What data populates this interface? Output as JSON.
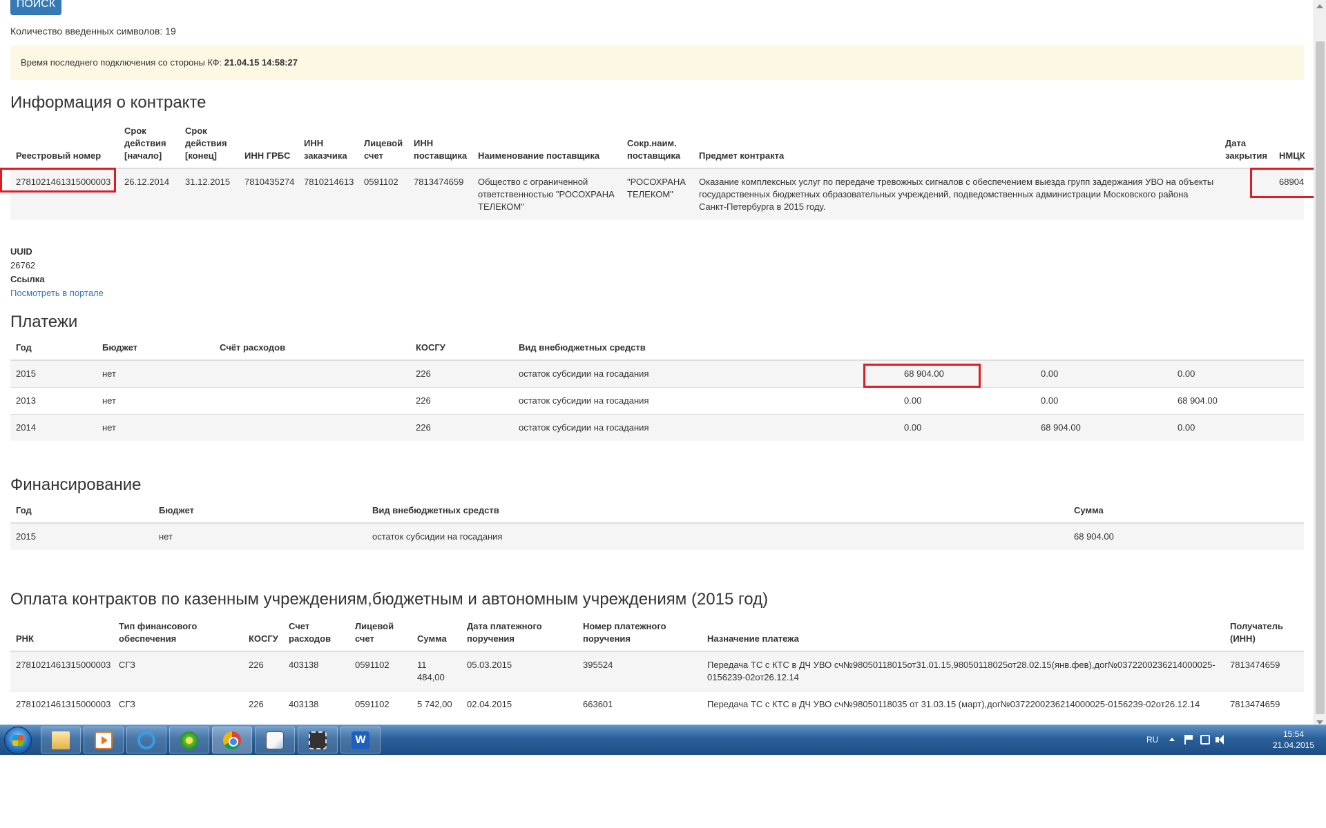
{
  "search_button": "ПОИСК",
  "char_count": "Количество введенных символов: 19",
  "alert": {
    "label": "Время последнего подключения со стороны КФ:",
    "value": "21.04.15 14:58:27"
  },
  "contract": {
    "title": "Информация о контракте",
    "headers": [
      "Реестровый номер",
      "Срок действия [начало]",
      "Срок действия [конец]",
      "ИНН ГРБС",
      "ИНН заказчика",
      "Лицевой счет",
      "ИНН поставщика",
      "Наименование поставщика",
      "Сокр.наим. поставщика",
      "Предмет контракта",
      "Дата закрытия",
      "НМЦК"
    ],
    "row": [
      "2781021461315000003",
      "26.12.2014",
      "31.12.2015",
      "7810435274",
      "7810214613",
      "0591102",
      "7813474659",
      "Общество с ограниченной ответственностью \"РОСОХРАНА ТЕЛЕКОМ\"",
      "\"РОСОХРАНА ТЕЛЕКОМ\"",
      "Оказание комплексных услуг по передаче тревожных сигналов с обеспечением выезда групп задержания УВО на объекты государственных бюджетных образовательных учреждений, подведомственных администрации Московского района Санкт-Петербурга в 2015 году.",
      "",
      "68904"
    ]
  },
  "uuid": {
    "label": "UUID",
    "value": "26762",
    "link_label": "Ссылка",
    "link_text": "Посмотреть в портале"
  },
  "payments": {
    "title": "Платежи",
    "headers": [
      "Год",
      "Бюджет",
      "Счёт расходов",
      "КОСГУ",
      "Вид внебюджетных средств",
      "",
      "",
      ""
    ],
    "rows": [
      [
        "2015",
        "нет",
        "",
        "226",
        "остаток субсидии на госадания",
        "68 904.00",
        "0.00",
        "0.00"
      ],
      [
        "2013",
        "нет",
        "",
        "226",
        "остаток субсидии на госадания",
        "0.00",
        "0.00",
        "68 904.00"
      ],
      [
        "2014",
        "нет",
        "",
        "226",
        "остаток субсидии на госадания",
        "0.00",
        "68 904.00",
        "0.00"
      ]
    ]
  },
  "financing": {
    "title": "Финансирование",
    "headers": [
      "Год",
      "Бюджет",
      "Вид внебюджетных средств",
      "Сумма"
    ],
    "rows": [
      [
        "2015",
        "нет",
        "остаток субсидии на госадания",
        "68 904.00"
      ]
    ]
  },
  "contract_payments": {
    "title": "Оплата контрактов по казенным учреждениям,бюджетным и автономным учреждениям (2015 год)",
    "headers": [
      "РНК",
      "Тип финансового обеспечения",
      "КОСГУ",
      "Счет расходов",
      "Лицевой счет",
      "Сумма",
      "Дата платежного поручения",
      "Номер платежного поручения",
      "Назначение платежа",
      "Получатель (ИНН)"
    ],
    "rows": [
      [
        "2781021461315000003",
        "СГЗ",
        "226",
        "403138",
        "0591102",
        "11 484,00",
        "05.03.2015",
        "395524",
        "Передача ТС с КТС в ДЧ УВО сч№98050118015от31.01.15,98050118025от28.02.15(янв.фев),дог№0372200236214000025-0156239-02от26.12.14",
        "7813474659"
      ],
      [
        "2781021461315000003",
        "СГЗ",
        "226",
        "403138",
        "0591102",
        "5 742,00",
        "02.04.2015",
        "663601",
        "Передача ТС с КТС в ДЧ УВО сч№98050118035 от 31.03.15 (март),дог№0372200236214000025-0156239-02от26.12.14",
        "7813474659"
      ]
    ]
  },
  "taskbar": {
    "apps": [
      "folder-icon",
      "media-player-icon",
      "internet-explorer-icon",
      "icq-icon",
      "chrome-icon",
      "notepad-icon",
      "film-icon",
      "word-icon"
    ],
    "lang": "RU",
    "time": "15:54",
    "date": "21.04.2015"
  },
  "colors": {
    "accent": "#337ab7",
    "highlight_box": "#e01b22",
    "alert_bg": "#fcf8e3",
    "stripe": "#f5f5f5"
  }
}
